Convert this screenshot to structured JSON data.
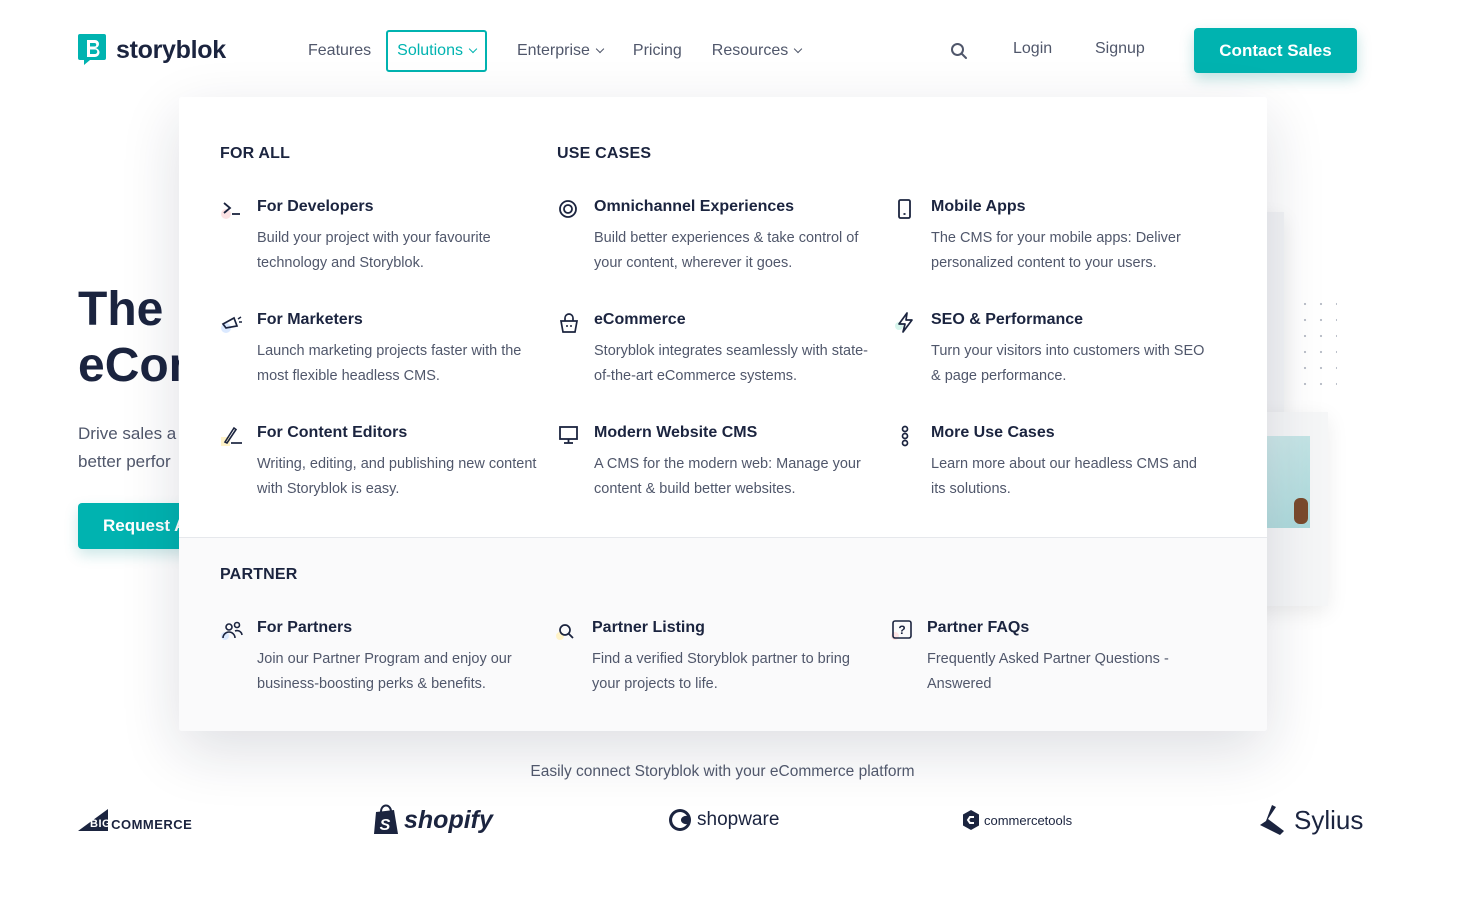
{
  "brand": {
    "name": "storyblok",
    "accent": "#00b3b0",
    "dark": "#1b243f"
  },
  "nav": {
    "items": [
      {
        "label": "Features",
        "has_menu": false
      },
      {
        "label": "Solutions",
        "has_menu": true,
        "active": true
      },
      {
        "label": "Enterprise",
        "has_menu": true
      },
      {
        "label": "Pricing",
        "has_menu": false
      },
      {
        "label": "Resources",
        "has_menu": true
      }
    ],
    "login": "Login",
    "signup": "Signup",
    "contact": "Contact Sales"
  },
  "hero": {
    "title_line1": "The r",
    "title_line2": "eCon",
    "sub_line1": "Drive sales a",
    "sub_line2": "better perfor",
    "button": "Request A"
  },
  "dropdown": {
    "for_all": {
      "heading": "FOR ALL",
      "items": [
        {
          "title": "For Developers",
          "desc": "Build your project with your favourite technology and Storyblok.",
          "icon": "terminal-icon"
        },
        {
          "title": "For Marketers",
          "desc": "Launch marketing projects faster with the most flexible headless CMS.",
          "icon": "megaphone-icon"
        },
        {
          "title": "For Content Editors",
          "desc": "Writing, editing, and publishing new content with Storyblok is easy.",
          "icon": "pen-icon"
        }
      ]
    },
    "use_cases": {
      "heading": "USE CASES",
      "items": [
        {
          "title": "Omnichannel Experiences",
          "desc": "Build better experiences & take control of your content, wherever it goes.",
          "icon": "target-icon"
        },
        {
          "title": "eCommerce",
          "desc": "Storyblok integrates seamlessly with state-of-the-art eCommerce systems.",
          "icon": "basket-icon"
        },
        {
          "title": "Modern Website CMS",
          "desc": "A CMS for the modern web: Manage your content & build better websites.",
          "icon": "monitor-icon"
        },
        {
          "title": "Mobile Apps",
          "desc": "The CMS for your mobile apps: Deliver personalized content to your users.",
          "icon": "phone-icon"
        },
        {
          "title": "SEO & Performance",
          "desc": "Turn your visitors into customers with SEO & page performance.",
          "icon": "bolt-icon"
        },
        {
          "title": "More Use Cases",
          "desc": "Learn more about our headless CMS and its solutions.",
          "icon": "more-icon"
        }
      ]
    },
    "partner": {
      "heading": "PARTNER",
      "items": [
        {
          "title": "For Partners",
          "desc": "Join our Partner Program and enjoy our business-boosting perks & benefits.",
          "icon": "users-icon"
        },
        {
          "title": "Partner Listing",
          "desc": "Find a verified Storyblok partner to bring your projects to life.",
          "icon": "search-icon"
        },
        {
          "title": "Partner FAQs",
          "desc": "Frequently Asked Partner Questions - Answered",
          "icon": "question-icon"
        }
      ]
    }
  },
  "partners_section": {
    "caption": "Easily connect Storyblok with your eCommerce platform",
    "logos": [
      {
        "name": "bigcommerce",
        "text_a": "BIG",
        "text_b": "COMMERCE"
      },
      {
        "name": "shopify",
        "text": "shopify"
      },
      {
        "name": "shopware",
        "text": "shopware"
      },
      {
        "name": "commercetools",
        "text": "commercetools"
      },
      {
        "name": "sylius",
        "text": "Sylius"
      }
    ]
  }
}
